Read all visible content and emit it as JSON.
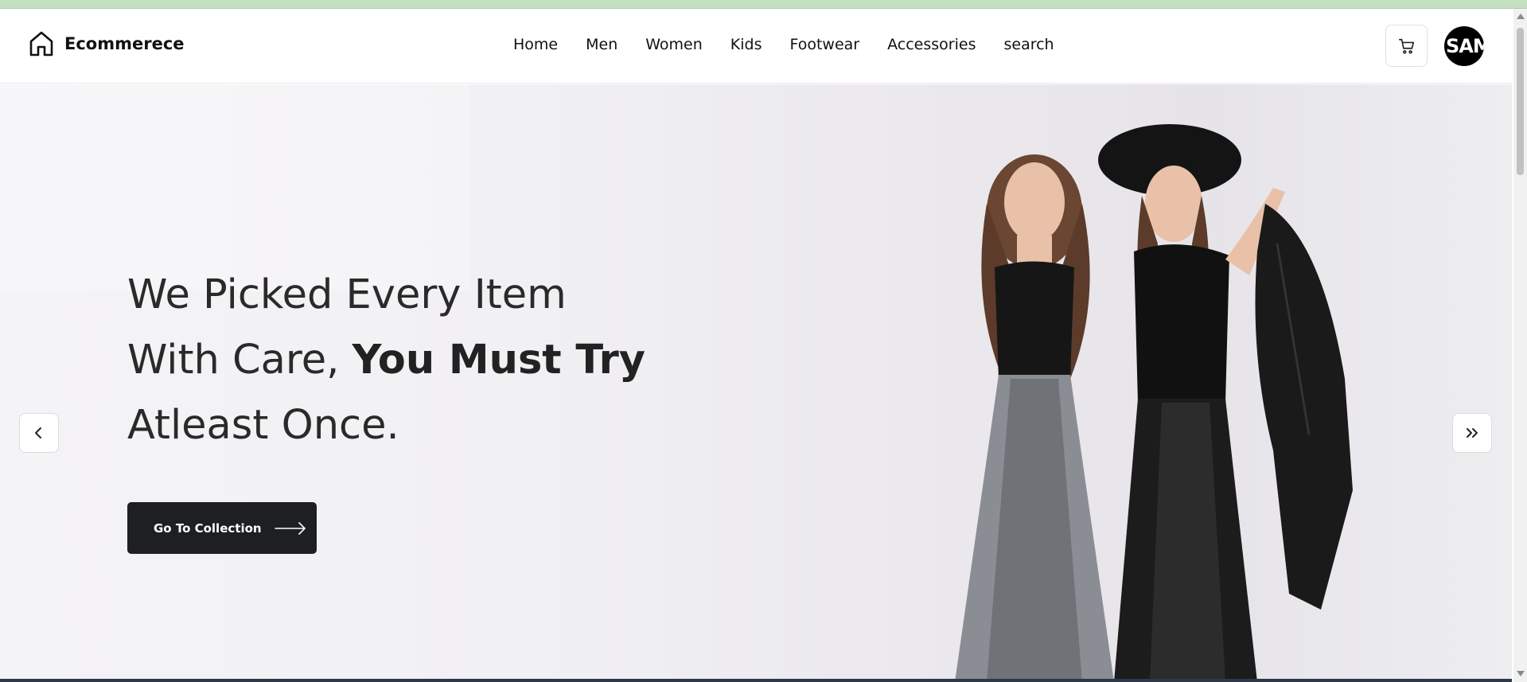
{
  "brand": {
    "name": "Ecommerece",
    "icon": "home-icon"
  },
  "nav": {
    "links": [
      {
        "label": "Home"
      },
      {
        "label": "Men"
      },
      {
        "label": "Women"
      },
      {
        "label": "Kids"
      },
      {
        "label": "Footwear"
      },
      {
        "label": "Accessories"
      },
      {
        "label": "search"
      }
    ]
  },
  "header_actions": {
    "cart_icon": "cart-icon",
    "avatar_text": "SAM"
  },
  "hero": {
    "headline_line1": "We Picked Every Item",
    "headline_line2_regular": "With Care,",
    "headline_line2_bold": "You Must Try",
    "headline_line3": "Atleast Once.",
    "cta_label": "Go To Collection",
    "cta_icon": "arrow-right-icon",
    "prev_icon": "chevron-left-icon",
    "next_icon": "double-chevron-right-icon"
  },
  "colors": {
    "top_strip": "#c5e1c4",
    "button_dark": "#1e1f22",
    "hero_bg": "#f1f0f3"
  }
}
